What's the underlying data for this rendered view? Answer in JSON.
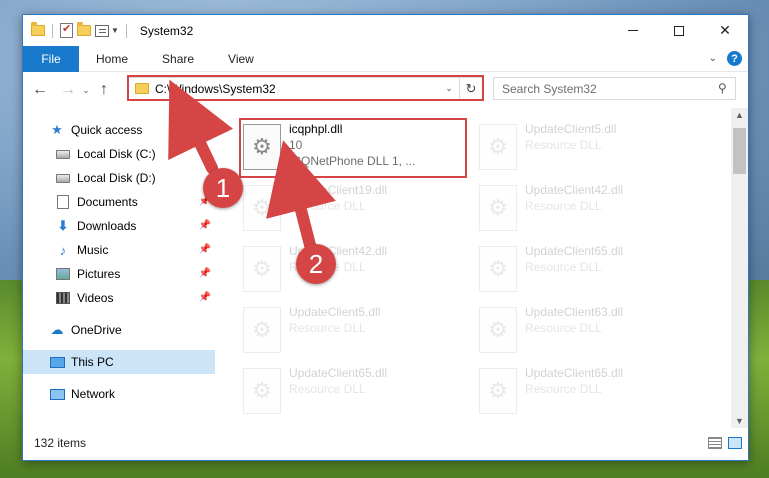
{
  "window": {
    "title": "System32",
    "controls": {
      "minimize": "",
      "maximize": "",
      "close": "✕"
    }
  },
  "ribbon": {
    "tabs": [
      "File",
      "Home",
      "Share",
      "View"
    ]
  },
  "address_bar": {
    "path": "C:\\Windows\\System32",
    "search_placeholder": "Search System32"
  },
  "sidebar": {
    "items": [
      {
        "label": "Quick access",
        "icon": "star-icon"
      },
      {
        "label": "Local Disk (C:)",
        "icon": "drive-icon"
      },
      {
        "label": "Local Disk (D:)",
        "icon": "drive-icon"
      },
      {
        "label": "Documents",
        "icon": "documents-icon",
        "pinned": true
      },
      {
        "label": "Downloads",
        "icon": "downloads-icon",
        "pinned": true
      },
      {
        "label": "Music",
        "icon": "music-icon",
        "pinned": true
      },
      {
        "label": "Pictures",
        "icon": "pictures-icon",
        "pinned": true
      },
      {
        "label": "Videos",
        "icon": "videos-icon",
        "pinned": true
      },
      {
        "label": "OneDrive",
        "icon": "onedrive-icon"
      },
      {
        "label": "This PC",
        "icon": "pc-icon",
        "selected": true
      },
      {
        "label": "Network",
        "icon": "network-icon"
      }
    ]
  },
  "files": {
    "highlighted": {
      "name": "icqphpl.dll",
      "line2": "10",
      "line3": "ICQNetPhone DLL 1, ..."
    },
    "background": [
      {
        "name": "UpdateClient5.dll",
        "desc": "Resource DLL"
      },
      {
        "name": "UpdateClient19.dll",
        "desc": "Resource DLL"
      },
      {
        "name": "UpdateClient42.dll",
        "desc": "Resource DLL"
      },
      {
        "name": "UpdateClient42.dll",
        "desc": "Resource DLL"
      },
      {
        "name": "UpdateClient65.dll",
        "desc": "Resource DLL"
      },
      {
        "name": "UpdateClient5.dll",
        "desc": "Resource DLL"
      },
      {
        "name": "UpdateClient63.dll",
        "desc": "Resource DLL"
      },
      {
        "name": "UpdateClient65.dll",
        "desc": "Resource DLL"
      },
      {
        "name": "UpdateClient65.dll",
        "desc": "Resource DLL"
      }
    ]
  },
  "status": {
    "item_count": "132 items"
  },
  "annotations": {
    "step1": "1",
    "step2": "2"
  },
  "colors": {
    "accent": "#1979ca",
    "highlight": "#d64545"
  }
}
